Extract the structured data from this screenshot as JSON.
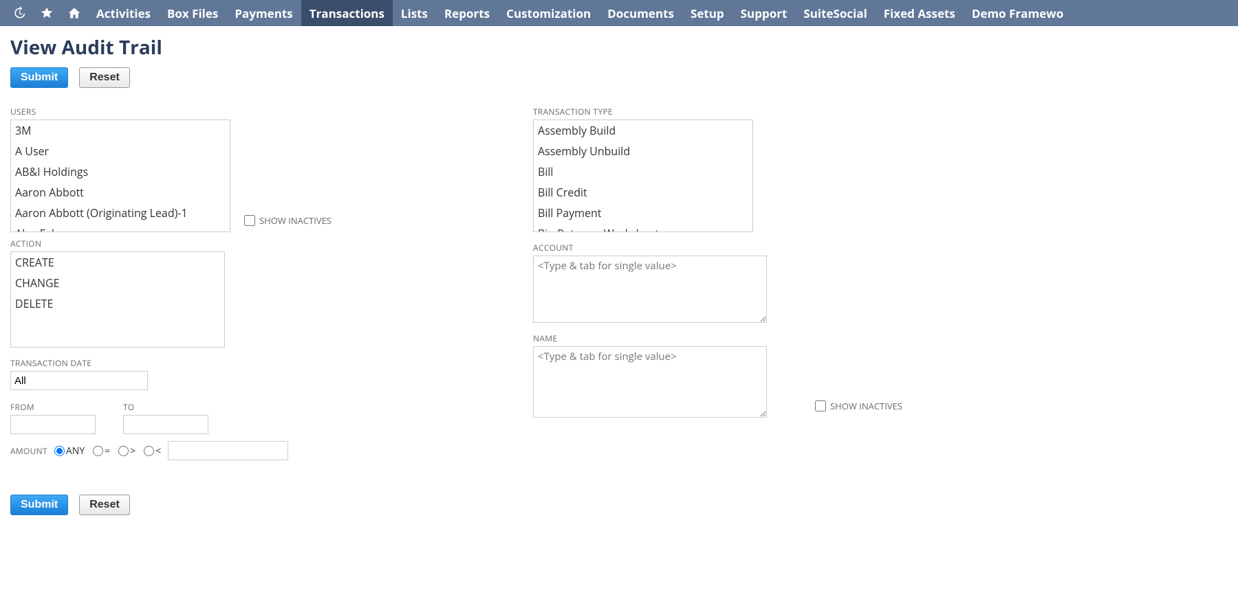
{
  "nav": {
    "items": [
      {
        "label": "Activities",
        "active": false
      },
      {
        "label": "Box Files",
        "active": false
      },
      {
        "label": "Payments",
        "active": false
      },
      {
        "label": "Transactions",
        "active": true
      },
      {
        "label": "Lists",
        "active": false
      },
      {
        "label": "Reports",
        "active": false
      },
      {
        "label": "Customization",
        "active": false
      },
      {
        "label": "Documents",
        "active": false
      },
      {
        "label": "Setup",
        "active": false
      },
      {
        "label": "Support",
        "active": false
      },
      {
        "label": "SuiteSocial",
        "active": false
      },
      {
        "label": "Fixed Assets",
        "active": false
      },
      {
        "label": "Demo Framewo"
      }
    ]
  },
  "page": {
    "title": "View Audit Trail"
  },
  "buttons": {
    "submit": "Submit",
    "reset": "Reset"
  },
  "labels": {
    "users": "USERS",
    "show_inactives": "SHOW INACTIVES",
    "action": "ACTION",
    "transaction_date": "TRANSACTION DATE",
    "from": "FROM",
    "to": "TO",
    "amount": "AMOUNT",
    "transaction_type": "TRANSACTION TYPE",
    "account": "ACCOUNT",
    "name": "NAME"
  },
  "users": {
    "options": [
      "3M",
      "A User",
      "AB&I Holdings",
      "Aaron Abbott",
      "Aaron Abbott (Originating Lead)-1",
      "Alex Fehrs"
    ]
  },
  "action": {
    "options": [
      "CREATE",
      "CHANGE",
      "DELETE"
    ]
  },
  "transaction_date": {
    "value": "All",
    "from": "",
    "to": ""
  },
  "amount": {
    "opts": {
      "any": "ANY",
      "eq": "=",
      "gt": ">",
      "lt": "<"
    },
    "selected": "any",
    "value": ""
  },
  "transaction_type": {
    "options": [
      "Assembly Build",
      "Assembly Unbuild",
      "Bill",
      "Bill Credit",
      "Bill Payment",
      "Bin Putaway Worksheet"
    ]
  },
  "account": {
    "placeholder": "<Type & tab for single value>"
  },
  "name_field": {
    "placeholder": "<Type & tab for single value>"
  }
}
